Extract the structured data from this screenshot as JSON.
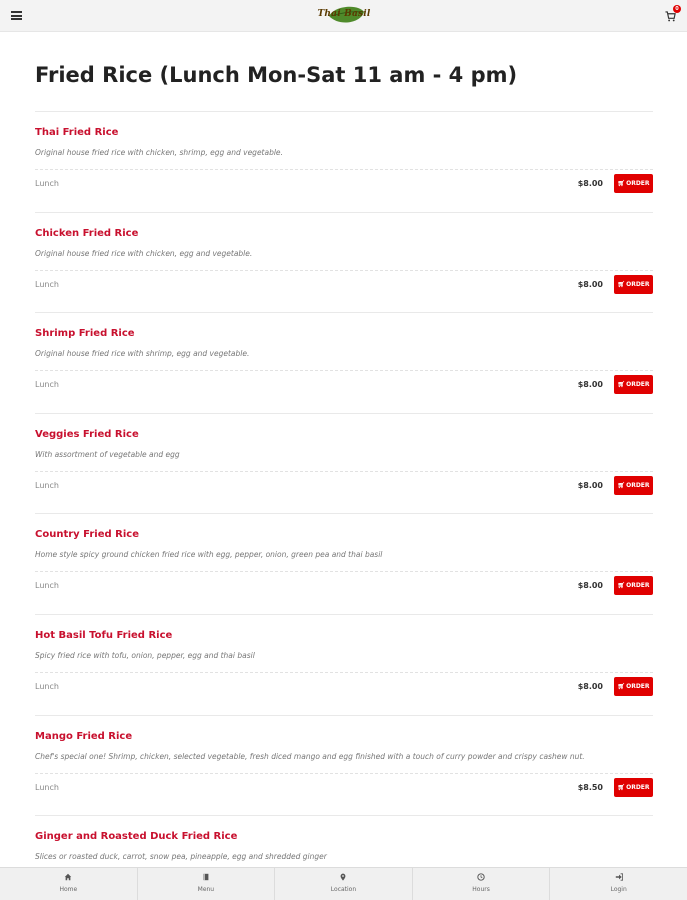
{
  "header": {
    "logo_text": "Thai Basil",
    "cart_count": "0"
  },
  "page": {
    "title": "Fried Rice (Lunch Mon-Sat 11 am - 4 pm)"
  },
  "colors": {
    "accent": "#c8102e",
    "button": "#e00000"
  },
  "items": [
    {
      "name": "Thai Fried Rice",
      "desc": "Original house fried rice with chicken, shrimp, egg and vegetable.",
      "size": "Lunch",
      "price": "$8.00",
      "order": "ORDER"
    },
    {
      "name": "Chicken Fried Rice",
      "desc": "Original house fried rice with chicken, egg and vegetable.",
      "size": "Lunch",
      "price": "$8.00",
      "order": "ORDER"
    },
    {
      "name": "Shrimp Fried Rice",
      "desc": "Original house fried rice with shrimp, egg and vegetable.",
      "size": "Lunch",
      "price": "$8.00",
      "order": "ORDER"
    },
    {
      "name": "Veggies Fried Rice",
      "desc": "With assortment of vegetable and egg",
      "size": "Lunch",
      "price": "$8.00",
      "order": "ORDER"
    },
    {
      "name": "Country Fried Rice",
      "desc": "Home style spicy ground chicken fried rice with egg, pepper, onion, green pea and thai basil",
      "size": "Lunch",
      "price": "$8.00",
      "order": "ORDER"
    },
    {
      "name": "Hot Basil Tofu Fried Rice",
      "desc": "Spicy fried rice with tofu, onion, pepper, egg and thai basil",
      "size": "Lunch",
      "price": "$8.00",
      "order": "ORDER"
    },
    {
      "name": "Mango Fried Rice",
      "desc": "Chef's special one! Shrimp, chicken, selected vegetable, fresh diced mango and egg finished with a touch of curry powder and crispy cashew nut.",
      "size": "Lunch",
      "price": "$8.50",
      "order": "ORDER"
    },
    {
      "name": "Ginger and Roasted Duck Fried Rice",
      "desc": "Slices or roasted duck, carrot, snow pea, pineapple, egg and shredded ginger",
      "size": "",
      "price": "",
      "order": ""
    }
  ],
  "nav": [
    {
      "label": "Home",
      "icon": "home-icon"
    },
    {
      "label": "Menu",
      "icon": "book-icon"
    },
    {
      "label": "Location",
      "icon": "map-pin-icon"
    },
    {
      "label": "Hours",
      "icon": "clock-icon"
    },
    {
      "label": "Login",
      "icon": "login-icon"
    }
  ]
}
